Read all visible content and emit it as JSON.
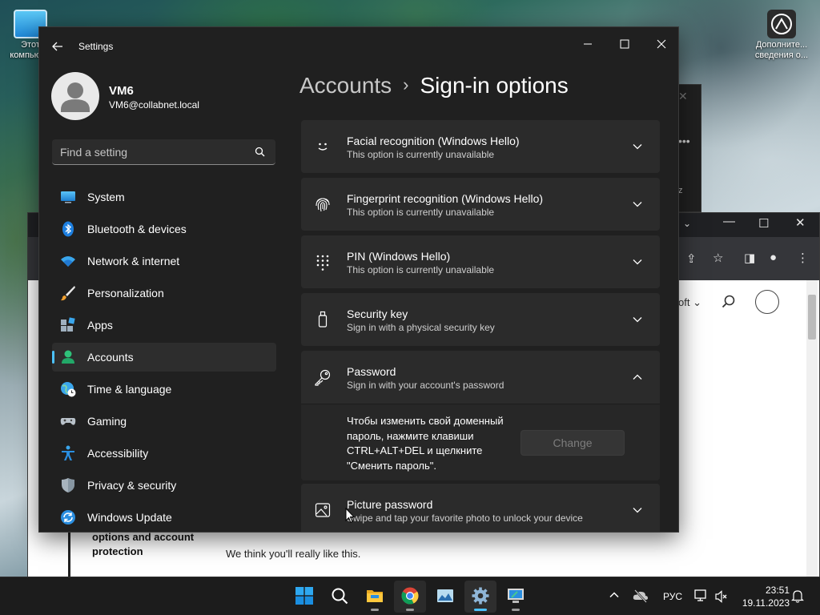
{
  "desktop": {
    "icons": [
      {
        "label": "Этот компьют..."
      },
      {
        "label": "Дополните... сведения о..."
      }
    ]
  },
  "background_browser": {
    "page_text_side": "options and account protection",
    "page_text_like": "We think you'll really like this.",
    "header_menu": "oft ⌄"
  },
  "settings": {
    "app_title": "Settings",
    "profile": {
      "name": "VM6",
      "email": "VM6@collabnet.local"
    },
    "search": {
      "placeholder": "Find a setting"
    },
    "nav": [
      {
        "label": "System",
        "icon": "monitor-icon",
        "active": false
      },
      {
        "label": "Bluetooth & devices",
        "icon": "bluetooth-icon",
        "active": false
      },
      {
        "label": "Network & internet",
        "icon": "wifi-icon",
        "active": false
      },
      {
        "label": "Personalization",
        "icon": "brush-icon",
        "active": false
      },
      {
        "label": "Apps",
        "icon": "apps-icon",
        "active": false
      },
      {
        "label": "Accounts",
        "icon": "person-icon",
        "active": true
      },
      {
        "label": "Time & language",
        "icon": "globe-clock-icon",
        "active": false
      },
      {
        "label": "Gaming",
        "icon": "gamepad-icon",
        "active": false
      },
      {
        "label": "Accessibility",
        "icon": "accessibility-icon",
        "active": false
      },
      {
        "label": "Privacy & security",
        "icon": "shield-icon",
        "active": false
      },
      {
        "label": "Windows Update",
        "icon": "update-icon",
        "active": false
      }
    ],
    "breadcrumb": {
      "parent": "Accounts",
      "separator": "›",
      "current": "Sign-in options"
    },
    "options": [
      {
        "title": "Facial recognition (Windows Hello)",
        "subtitle": "This option is currently unavailable",
        "icon": "smile-icon",
        "expanded": false
      },
      {
        "title": "Fingerprint recognition (Windows Hello)",
        "subtitle": "This option is currently unavailable",
        "icon": "fingerprint-icon",
        "expanded": false
      },
      {
        "title": "PIN (Windows Hello)",
        "subtitle": "This option is currently unavailable",
        "icon": "keypad-icon",
        "expanded": false
      },
      {
        "title": "Security key",
        "subtitle": "Sign in with a physical security key",
        "icon": "usb-key-icon",
        "expanded": false
      },
      {
        "title": "Password",
        "subtitle": "Sign in with your account's password",
        "icon": "key-icon",
        "expanded": true
      },
      {
        "title": "Picture password",
        "subtitle": "Swipe and tap your favorite photo to unlock your device",
        "icon": "picture-icon",
        "expanded": false
      }
    ],
    "password_panel": {
      "message": "Чтобы изменить свой доменный пароль, нажмите клавиши CTRL+ALT+DEL и щелкните \"Сменить пароль\".",
      "button_label": "Change"
    }
  },
  "taskbar": {
    "apps": [
      {
        "name": "start-button"
      },
      {
        "name": "search-button"
      },
      {
        "name": "file-explorer"
      },
      {
        "name": "chrome"
      },
      {
        "name": "photos"
      },
      {
        "name": "settings",
        "active": true
      },
      {
        "name": "remote-desktop"
      }
    ],
    "language": "РУС",
    "time": "23:51",
    "date": "19.11.2023"
  },
  "colors": {
    "accent": "#4cc2ff",
    "window_bg": "#202020",
    "card_bg": "#2b2b2b"
  }
}
